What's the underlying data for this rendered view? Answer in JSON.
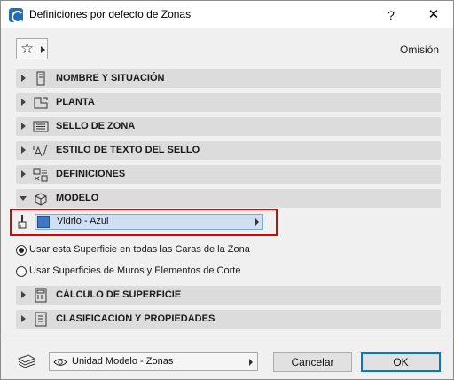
{
  "window": {
    "title": "Definiciones por defecto de Zonas",
    "help_glyph": "?",
    "close_glyph": "✕"
  },
  "favorites": {
    "icon": "star-icon",
    "star_glyph": "☆"
  },
  "default_label": "Omisión",
  "sections": [
    {
      "label": "NOMBRE Y SITUACIÓN",
      "icon": "name-location-icon",
      "expanded": false
    },
    {
      "label": "PLANTA",
      "icon": "floor-plan-icon",
      "expanded": false
    },
    {
      "label": "SELLO DE ZONA",
      "icon": "zone-stamp-icon",
      "expanded": false
    },
    {
      "label": "ESTILO DE TEXTO DEL SELLO",
      "icon": "text-style-icon",
      "expanded": false
    },
    {
      "label": "DEFINICIONES",
      "icon": "definitions-icon",
      "expanded": false
    },
    {
      "label": "MODELO",
      "icon": "model-box-icon",
      "expanded": true
    },
    {
      "label": "CÁLCULO DE SUPERFICIE",
      "icon": "area-calculator-icon",
      "expanded": false
    },
    {
      "label": "CLASIFICACIÓN Y PROPIEDADES",
      "icon": "classification-icon",
      "expanded": false
    }
  ],
  "model": {
    "surface_material": "Vidrio - Azul",
    "swatch_color": "#3f78c9",
    "radio_all_faces": "Usar esta Superficie en todas las Caras de la Zona",
    "radio_wall_surfaces": "Usar Superficies de Muros y Elementos de Corte",
    "selected_radio": "all_faces"
  },
  "footer": {
    "view_option": "Unidad Modelo - Zonas",
    "cancel_label": "Cancelar",
    "ok_label": "OK"
  },
  "colors": {
    "highlight_border": "#e00000",
    "selection_fill": "#cfe0f5",
    "ok_border": "#0078d7"
  }
}
